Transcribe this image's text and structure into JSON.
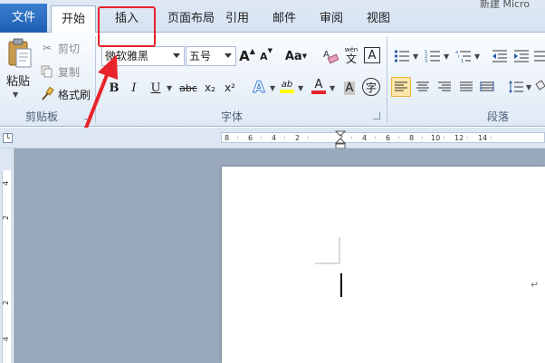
{
  "title_fragment": "新建 Micro",
  "tabs": {
    "file": "文件",
    "home": "开始",
    "insert": "插入",
    "layout": "页面布局",
    "references": "引用",
    "mailings": "邮件",
    "review": "审阅",
    "view": "视图"
  },
  "clipboard": {
    "paste": "粘贴",
    "cut": "剪切",
    "copy": "复制",
    "format_painter": "格式刷",
    "group_label": "剪贴板"
  },
  "font": {
    "name": "微软雅黑",
    "size": "五号",
    "group_label": "字体",
    "change_case": "Aa",
    "bold": "B",
    "italic": "I",
    "underline": "U",
    "strikethrough": "abc",
    "subscript": "x₂",
    "superscript": "x²",
    "phonetic_guide": "wén",
    "enclose": "字",
    "char_border": "A",
    "highlight": "ab",
    "font_color": "A",
    "text_effect": "A",
    "grow": "A",
    "shrink": "A",
    "clear_format": "A"
  },
  "paragraph": {
    "group_label": "段落"
  },
  "ruler": {
    "h_labels": [
      "8",
      "6",
      "4",
      "2",
      "2",
      "4",
      "6",
      "8",
      "10",
      "12",
      "14"
    ],
    "v_labels": [
      "4",
      "2",
      "2",
      "4"
    ]
  },
  "colors": {
    "accent": "#1f5fb0",
    "highlight_yellow": "#ffff00",
    "font_red": "#e8232a",
    "annotation_red": "#e8232a"
  }
}
